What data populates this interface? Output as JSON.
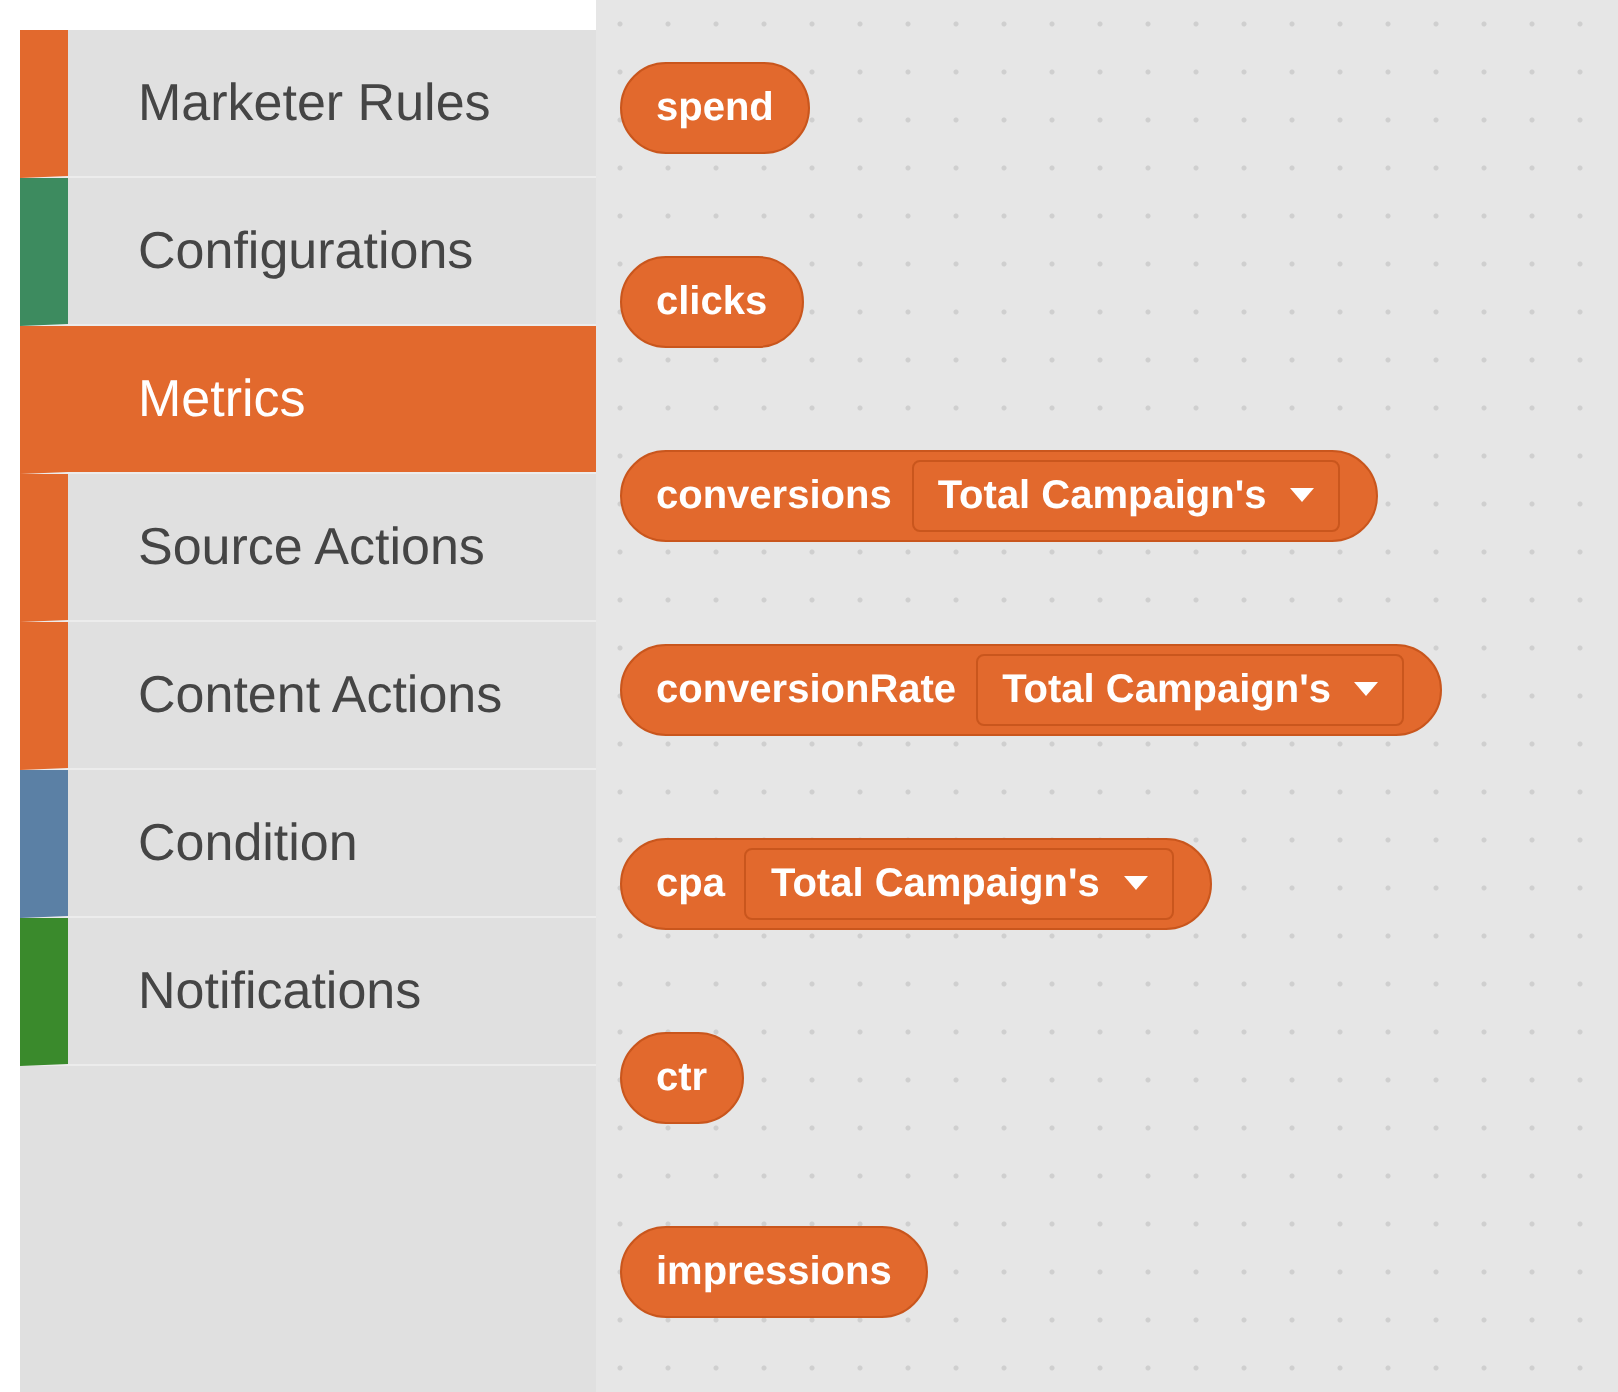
{
  "toolbox": {
    "categories": [
      {
        "label": "Marketer Rules",
        "color": "#e2692d",
        "selected": false
      },
      {
        "label": "Configurations",
        "color": "#3d8b5f",
        "selected": false
      },
      {
        "label": "Metrics",
        "color": "#e2692d",
        "selected": true
      },
      {
        "label": "Source Actions",
        "color": "#e2692d",
        "selected": false
      },
      {
        "label": "Content Actions",
        "color": "#e2692d",
        "selected": false
      },
      {
        "label": "Condition",
        "color": "#5b80a5",
        "selected": false
      },
      {
        "label": "Notifications",
        "color": "#3a8a2c",
        "selected": false
      }
    ]
  },
  "flyout": {
    "blocks": [
      {
        "kind": "plain",
        "label": "spend"
      },
      {
        "kind": "plain",
        "label": "clicks"
      },
      {
        "kind": "dropdown",
        "label": "conversions",
        "dropdown": "Total Campaign's"
      },
      {
        "kind": "dropdown",
        "label": "conversionRate",
        "dropdown": "Total Campaign's"
      },
      {
        "kind": "dropdown",
        "label": "cpa",
        "dropdown": "Total Campaign's"
      },
      {
        "kind": "plain",
        "label": "ctr"
      },
      {
        "kind": "plain",
        "label": "impressions"
      }
    ]
  }
}
